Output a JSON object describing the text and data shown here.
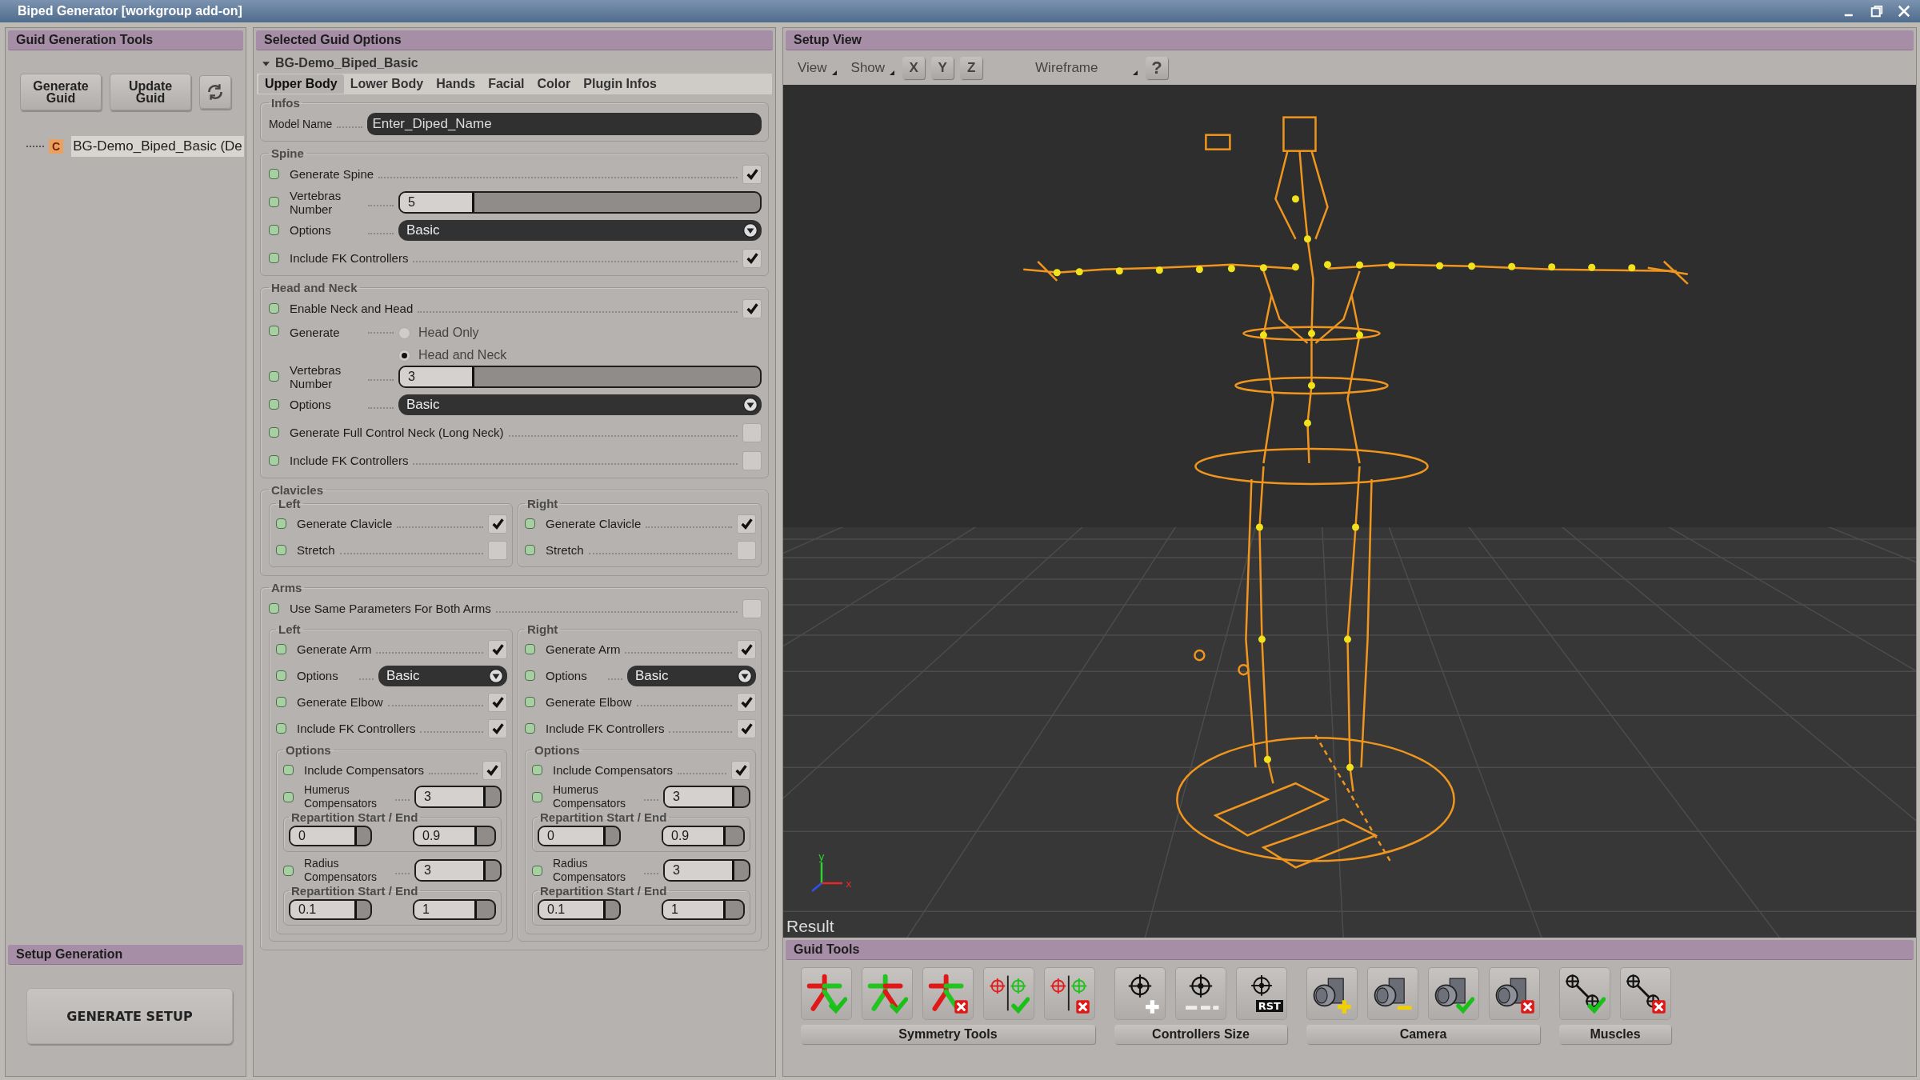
{
  "window": {
    "title": "Biped Generator [workgroup add-on]"
  },
  "guid_generation_tools": {
    "title": "Guid Generation Tools",
    "buttons": [
      {
        "label": "Generate Guid"
      },
      {
        "label": "Update Guid"
      }
    ],
    "tree": [
      {
        "badge": "C",
        "label": "BG-Demo_Biped_Basic (De",
        "selected": true
      }
    ]
  },
  "setup_generation": {
    "title": "Setup Generation",
    "button": "GENERATE SETUP"
  },
  "options_panel": {
    "title": "Selected Guid Options",
    "guid": {
      "label": "BG-Demo_Biped_Basic",
      "expanded": true
    },
    "tabs": [
      {
        "label": "Upper Body",
        "selected": true
      },
      {
        "label": "Lower Body",
        "selected": false
      },
      {
        "label": "Hands",
        "selected": false
      },
      {
        "label": "Facial",
        "selected": false
      },
      {
        "label": "Color",
        "selected": false
      },
      {
        "label": "Plugin Infos",
        "selected": false
      }
    ],
    "sections": [
      {
        "title": "Infos",
        "rows": [
          {
            "kind": "text",
            "label": "Model Name",
            "value": "Enter_Diped_Name"
          }
        ]
      },
      {
        "title": "Spine",
        "rows": [
          {
            "kind": "check",
            "label": "Generate Spine",
            "checked": true
          },
          {
            "kind": "slider",
            "label": "Vertebras Number",
            "value": "5",
            "level": 0.2
          },
          {
            "kind": "dropdown",
            "label": "Options",
            "value": "Basic"
          },
          {
            "kind": "check",
            "label": "Include FK Controllers",
            "checked": true
          }
        ]
      },
      {
        "title": "Head and Neck",
        "rows": [
          {
            "kind": "check",
            "label": "Enable Neck and Head",
            "checked": true
          },
          {
            "kind": "radio",
            "label": "Generate",
            "options": [
              {
                "label": "Head Only",
                "selected": false
              },
              {
                "label": "Head and Neck",
                "selected": true
              }
            ]
          },
          {
            "kind": "slider",
            "label": "Vertebras Number",
            "value": "3",
            "level": 0.2
          },
          {
            "kind": "dropdown",
            "label": "Options",
            "value": "Basic"
          },
          {
            "kind": "check",
            "label": "Generate Full Control Neck (Long Neck)",
            "checked": false
          },
          {
            "kind": "check",
            "label": "Include FK Controllers",
            "checked": false
          }
        ]
      },
      {
        "title": "Clavicles",
        "sides": [
          {
            "title": "Left",
            "rows": [
              {
                "kind": "check",
                "label": "Generate Clavicle",
                "checked": true
              },
              {
                "kind": "check",
                "label": "Stretch",
                "checked": false
              }
            ]
          },
          {
            "title": "Right",
            "rows": [
              {
                "kind": "check",
                "label": "Generate Clavicle",
                "checked": true
              },
              {
                "kind": "check",
                "label": "Stretch",
                "checked": false
              }
            ]
          }
        ]
      },
      {
        "title": "Arms",
        "rows": [
          {
            "kind": "check",
            "label": "Use Same Parameters For Both Arms",
            "checked": false
          }
        ],
        "sides": [
          {
            "title": "Left",
            "rows": [
              {
                "kind": "check",
                "label": "Generate Arm",
                "checked": true
              },
              {
                "kind": "dropdown",
                "label": "Options",
                "value": "Basic"
              },
              {
                "kind": "check",
                "label": "Generate Elbow",
                "checked": true
              },
              {
                "kind": "check",
                "label": "Include FK Controllers",
                "checked": true
              }
            ],
            "sub": {
              "title": "Options",
              "rows": [
                {
                  "kind": "check",
                  "label": "Include Compensators",
                  "checked": true
                },
                {
                  "kind": "slider",
                  "label": "Humerus Compensators",
                  "value": "3",
                  "level": 0.8
                },
                {
                  "kind": "range",
                  "title": "Repartition Start / End",
                  "fields": [
                    {
                      "value": "0",
                      "level": 0.8
                    },
                    {
                      "value": "0.9",
                      "level": 0.75
                    }
                  ]
                },
                {
                  "kind": "slider",
                  "label": "Radius Compensators",
                  "value": "3",
                  "level": 0.8
                },
                {
                  "kind": "range",
                  "title": "Repartition Start / End",
                  "fields": [
                    {
                      "value": "0.1",
                      "level": 0.8
                    },
                    {
                      "value": "1",
                      "level": 0.75
                    }
                  ]
                }
              ]
            }
          },
          {
            "title": "Right",
            "rows": [
              {
                "kind": "check",
                "label": "Generate Arm",
                "checked": true
              },
              {
                "kind": "dropdown",
                "label": "Options",
                "value": "Basic"
              },
              {
                "kind": "check",
                "label": "Generate Elbow",
                "checked": true
              },
              {
                "kind": "check",
                "label": "Include FK Controllers",
                "checked": true
              }
            ],
            "sub": {
              "title": "Options",
              "rows": [
                {
                  "kind": "check",
                  "label": "Include Compensators",
                  "checked": true
                },
                {
                  "kind": "slider",
                  "label": "Humerus Compensators",
                  "value": "3",
                  "level": 0.8
                },
                {
                  "kind": "range",
                  "title": "Repartition Start / End",
                  "fields": [
                    {
                      "value": "0",
                      "level": 0.8
                    },
                    {
                      "value": "0.9",
                      "level": 0.75
                    }
                  ]
                },
                {
                  "kind": "slider",
                  "label": "Radius Compensators",
                  "value": "3",
                  "level": 0.8
                },
                {
                  "kind": "range",
                  "title": "Repartition Start / End",
                  "fields": [
                    {
                      "value": "0.1",
                      "level": 0.8
                    },
                    {
                      "value": "1",
                      "level": 0.75
                    }
                  ]
                }
              ]
            }
          }
        ]
      }
    ]
  },
  "setup_view": {
    "title": "Setup View",
    "toolbar": [
      {
        "kind": "menu",
        "label": "View"
      },
      {
        "kind": "menu",
        "label": "Show"
      },
      {
        "kind": "axis",
        "label": "X"
      },
      {
        "kind": "axis",
        "label": "Y"
      },
      {
        "kind": "axis",
        "label": "Z"
      },
      {
        "kind": "dropdown",
        "label": "Wireframe"
      },
      {
        "kind": "help",
        "label": "?"
      }
    ],
    "viewport": {
      "label": "Result",
      "axes": [
        "y",
        "x"
      ]
    }
  },
  "guid_tools": {
    "title": "Guid Tools",
    "groups": [
      {
        "label": "Symmetry Tools",
        "tools": [
          {
            "kind": "mirror"
          },
          {
            "kind": "mirrorflip"
          },
          {
            "kind": "mirrorcancel"
          },
          {
            "kind": "targetsok"
          },
          {
            "kind": "targetscancel"
          }
        ]
      },
      {
        "label": "Controllers Size",
        "tools": [
          {
            "kind": "grow"
          },
          {
            "kind": "shrink"
          },
          {
            "kind": "reset",
            "label": "RST"
          }
        ]
      },
      {
        "label": "Camera",
        "tools": [
          {
            "kind": "camadd"
          },
          {
            "kind": "camremove"
          },
          {
            "kind": "camok"
          },
          {
            "kind": "camcancel"
          }
        ]
      },
      {
        "label": "Muscles",
        "tools": [
          {
            "kind": "muscleok"
          },
          {
            "kind": "musclecancel"
          }
        ]
      }
    ]
  }
}
